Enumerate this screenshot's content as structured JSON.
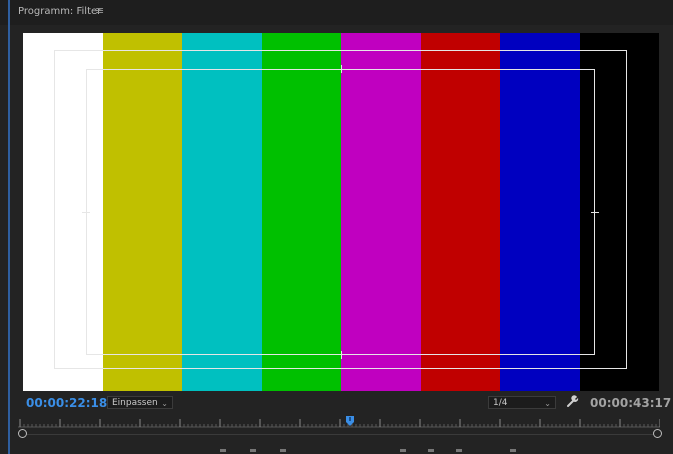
{
  "panel": {
    "title": "Programm: Filter",
    "menu_icon": "hamburger-icon"
  },
  "color_bars": [
    {
      "name": "white",
      "color": "#ffffff"
    },
    {
      "name": "yellow",
      "color": "#c0c000"
    },
    {
      "name": "cyan",
      "color": "#00c0c0"
    },
    {
      "name": "green",
      "color": "#00c000"
    },
    {
      "name": "magenta",
      "color": "#c000c0"
    },
    {
      "name": "red",
      "color": "#c00000"
    },
    {
      "name": "blue",
      "color": "#0000c0"
    },
    {
      "name": "black",
      "color": "#000000"
    }
  ],
  "controls": {
    "current_timecode": "00:00:22:18",
    "zoom_value": "Einpassen",
    "resolution_value": "1/4",
    "duration_timecode": "00:00:43:17",
    "settings_icon": "wrench-icon"
  },
  "colors": {
    "accent": "#3a8ee6",
    "background": "#232323"
  }
}
